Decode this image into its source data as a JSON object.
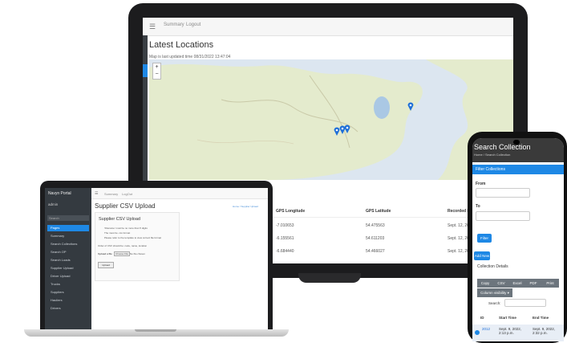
{
  "monitor": {
    "nav": [
      "Summary",
      "Logout"
    ],
    "heading": "Latest Locations",
    "last_updated": "Map is last updated time 08/31/2022 13:47:04",
    "zoom_in": "+",
    "zoom_out": "−",
    "table": {
      "columns": [
        "GPS Longitude",
        "GPS Latitude",
        "Recorded D"
      ],
      "rows": [
        [
          "-7.010653",
          "54.475563",
          "Sept. 12, 202"
        ],
        [
          "-6.155561",
          "54.611203",
          "Sept. 12, 202"
        ],
        [
          "-6.684440",
          "54.466027",
          "Sept. 12, 202"
        ]
      ]
    }
  },
  "laptop": {
    "brand": "Navyn Portal",
    "user": "admin",
    "search_placeholder": "Search",
    "menu": [
      "Pages",
      "Summary",
      "Search Collections",
      "Search OP",
      "Search Loads",
      "Supplier Upload",
      "Driver Upload",
      "Trucks",
      "Suppliers",
      "Hauliers",
      "Drivers"
    ],
    "nav": [
      "Summary",
      "LogOut"
    ],
    "page_title": "Supplier CSV Upload",
    "breadcrumb": "Home / Supplier Upload",
    "card_title": "Supplier CSV Upload",
    "bullets": [
      "'Filename' must be no more than 5 digits",
      "The must be .csv format",
      "Please refer to the template to view correct file format"
    ],
    "note": "Order of CSV should be: code, name, location",
    "upload_label": "Upload a file",
    "choose_file": "Choose File",
    "no_file": "No file chosen",
    "submit": "Upload"
  },
  "phone": {
    "title": "Search Collection",
    "breadcrumb": "Home / Search Collection",
    "filter_bar": "Filter Collections",
    "from_label": "From",
    "to_label": "To",
    "filter_btn": "Filter",
    "add_new": "Add New",
    "details": "Collection Details",
    "export_buttons": [
      "Copy",
      "CSV",
      "Excel",
      "PDF",
      "Print"
    ],
    "col_visibility": "Column visibility ▾",
    "search_label": "Search:",
    "table_headers": [
      "ID",
      "Start Time",
      "End Time"
    ],
    "row": {
      "id": "2012",
      "start": "Sept. 9, 2022, 2:13 p.m.",
      "end": "Sept. 9, 2022, 2:32 p.m."
    }
  },
  "map_markers": [
    {
      "label": "marker-1"
    },
    {
      "label": "marker-2"
    },
    {
      "label": "marker-3"
    },
    {
      "label": "marker-4"
    }
  ]
}
